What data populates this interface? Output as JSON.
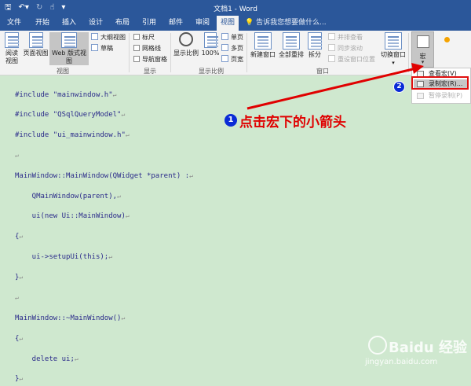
{
  "window": {
    "title": "文档1 - Word",
    "qat": [
      "save-icon",
      "undo-icon",
      "redo-icon",
      "touch-mode-icon"
    ]
  },
  "tabs": [
    {
      "label": "文件"
    },
    {
      "label": "开始"
    },
    {
      "label": "插入"
    },
    {
      "label": "设计"
    },
    {
      "label": "布局"
    },
    {
      "label": "引用"
    },
    {
      "label": "邮件"
    },
    {
      "label": "审阅"
    },
    {
      "label": "视图",
      "active": true
    }
  ],
  "tellme": "告诉我您想要做什么...",
  "ribbon": {
    "views": {
      "read_mode": "阅读\n视图",
      "print_layout": "页面视图",
      "web_layout": "Web 版式视图",
      "outline": "大纲视图",
      "draft": "草稿",
      "group_label": "视图"
    },
    "show": {
      "ruler": "标尺",
      "gridlines": "网格线",
      "nav_pane": "导航窗格",
      "group_label": "显示"
    },
    "zoom": {
      "zoom": "显示比例",
      "percent": "100%",
      "one_page": "单页",
      "multiple_pages": "多页",
      "page_width": "页宽",
      "group_label": "显示比例"
    },
    "window": {
      "new_window": "新建窗口",
      "arrange_all": "全部重排",
      "split": "拆分",
      "side_by_side": "并排查看",
      "sync_scroll": "同步滚动",
      "reset_position": "重设窗口位置",
      "switch_windows": "切换窗口",
      "group_label": "窗口"
    },
    "macros": {
      "label": "宏"
    }
  },
  "dropdown": {
    "view_macros": "查看宏(V)",
    "record_macro": "录制宏(R)...",
    "pause_recording": "暂停录制(P)"
  },
  "code": [
    {
      "text": "#include \"mainwindow.h\""
    },
    {
      "text": "#include \"QSqlQueryModel\""
    },
    {
      "text": "#include \"ui_mainwindow.h\""
    },
    {
      "text": ""
    },
    {
      "text": "MainWindow::MainWindow(QWidget *parent) :"
    },
    {
      "text": "    QMainWindow(parent),"
    },
    {
      "text": "    ui(new Ui::MainWindow)"
    },
    {
      "text": "{"
    },
    {
      "text": "    ui->setupUi(this);"
    },
    {
      "text": "}"
    },
    {
      "text": ""
    },
    {
      "text": "MainWindow::~MainWindow()"
    },
    {
      "text": "{"
    },
    {
      "text": "    delete ui;"
    },
    {
      "text": "}"
    }
  ],
  "annotation": {
    "step1_number": "1",
    "step1_text": "点击宏下的小箭头",
    "step2_number": "2",
    "arrow_color": "#e00000"
  },
  "watermark": {
    "brand": "Baidu 经验",
    "url": "jingyan.baidu.com"
  },
  "colors": {
    "word_blue": "#2b579a",
    "doc_background": "#cfe8cf",
    "highlight_red": "#e01010"
  }
}
